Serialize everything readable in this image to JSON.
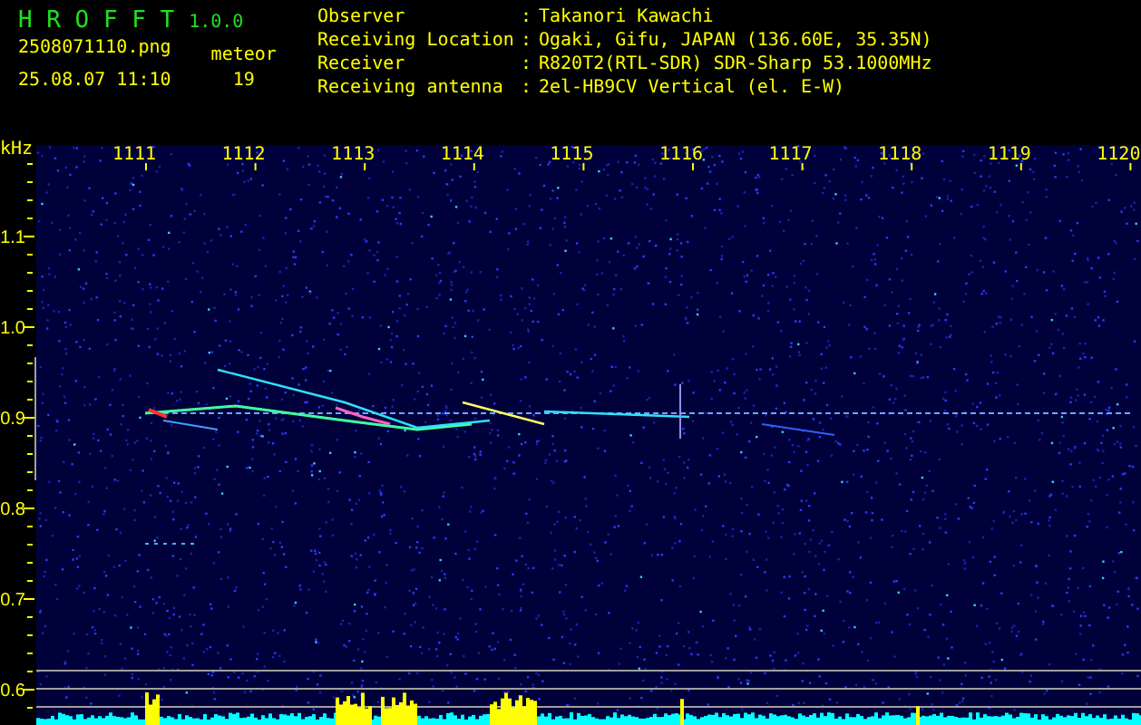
{
  "header": {
    "title": "H R O F F T",
    "version": "1.0.0",
    "file_name": "2508071110.png",
    "timestamp": "25.08.07 11:10",
    "meteor_label": "meteor",
    "meteor_count": "19"
  },
  "info": [
    {
      "label": "Observer",
      "separator": ":",
      "value": "Takanori Kawachi"
    },
    {
      "label": "Receiving Location",
      "separator": ":",
      "value": "Ogaki, Gifu, JAPAN (136.60E, 35.35N)"
    },
    {
      "label": "Receiver",
      "separator": ":",
      "value": "R820T2(RTL-SDR) SDR-Sharp 53.1000MHz"
    },
    {
      "label": "Receiving antenna",
      "separator": ":",
      "value": "2el-HB9CV Vertical (el. E-W)"
    }
  ],
  "spectrogram": {
    "unit": "kHz",
    "x_ticks": [
      "1111",
      "1112",
      "1113",
      "1114",
      "1115",
      "1116",
      "1117",
      "1118",
      "1119",
      "1120"
    ],
    "y_ticks": [
      "1.1",
      "1.0",
      "0.9",
      "0.8",
      "0.7",
      "0.6"
    ]
  }
}
